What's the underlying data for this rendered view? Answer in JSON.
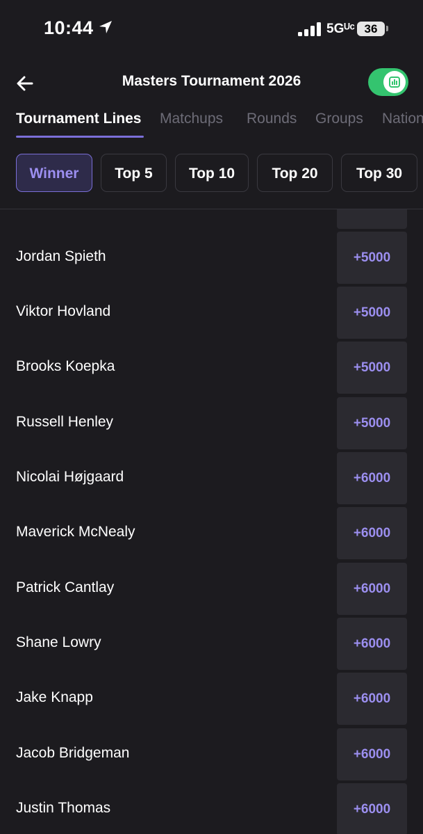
{
  "status_bar": {
    "time": "10:44",
    "network": "5Gᵁᶜ",
    "battery": "36"
  },
  "header": {
    "title": "Masters Tournament 2026"
  },
  "tabs": [
    {
      "label": "Tournament Lines"
    },
    {
      "label": "Matchups"
    },
    {
      "label": "Rounds"
    },
    {
      "label": "Groups"
    },
    {
      "label": "Nationality"
    }
  ],
  "filters": [
    {
      "label": "Winner"
    },
    {
      "label": "Top 5"
    },
    {
      "label": "Top 10"
    },
    {
      "label": "Top 20"
    },
    {
      "label": "Top 30"
    }
  ],
  "players": [
    {
      "name": "Jordan Spieth",
      "odds": "+5000"
    },
    {
      "name": "Viktor Hovland",
      "odds": "+5000"
    },
    {
      "name": "Brooks Koepka",
      "odds": "+5000"
    },
    {
      "name": "Russell Henley",
      "odds": "+5000"
    },
    {
      "name": "Nicolai Højgaard",
      "odds": "+6000"
    },
    {
      "name": "Maverick McNealy",
      "odds": "+6000"
    },
    {
      "name": "Patrick Cantlay",
      "odds": "+6000"
    },
    {
      "name": "Shane Lowry",
      "odds": "+6000"
    },
    {
      "name": "Jake Knapp",
      "odds": "+6000"
    },
    {
      "name": "Jacob Bridgeman",
      "odds": "+6000"
    },
    {
      "name": "Justin Thomas",
      "odds": "+6000"
    }
  ],
  "colors": {
    "accent": "#7b6fd8",
    "odds_text": "#9c8ff0",
    "toggle_on": "#34c46f",
    "background": "#1c1b1f"
  },
  "icons": {
    "back": "arrow-left-icon",
    "toggle": "chart-icon",
    "location": "location-arrow-icon"
  }
}
